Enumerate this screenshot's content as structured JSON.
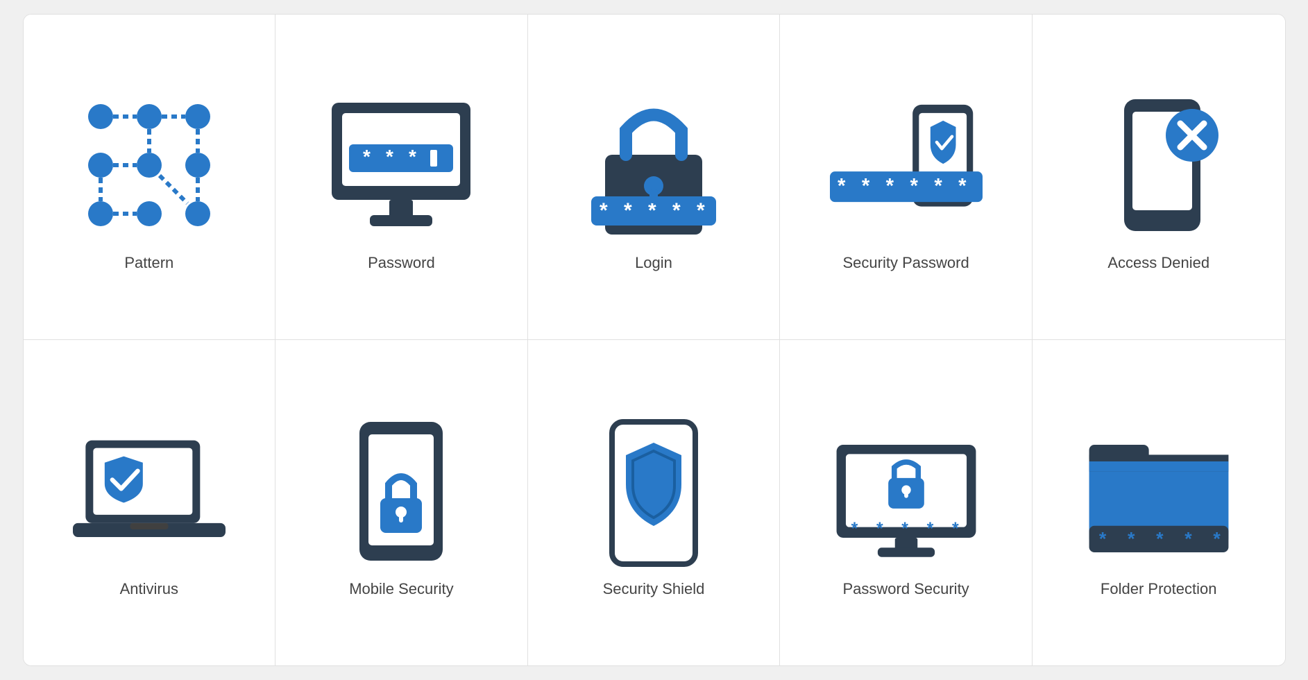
{
  "icons": [
    {
      "id": "pattern",
      "label": "Pattern"
    },
    {
      "id": "password",
      "label": "Password"
    },
    {
      "id": "login",
      "label": "Login"
    },
    {
      "id": "security-password",
      "label": "Security Password"
    },
    {
      "id": "access-denied",
      "label": "Access Denied"
    },
    {
      "id": "antivirus",
      "label": "Antivirus"
    },
    {
      "id": "mobile-security",
      "label": "Mobile Security"
    },
    {
      "id": "security-shield",
      "label": "Security Shield"
    },
    {
      "id": "password-security",
      "label": "Password Security"
    },
    {
      "id": "folder-protection",
      "label": "Folder Protection"
    }
  ]
}
